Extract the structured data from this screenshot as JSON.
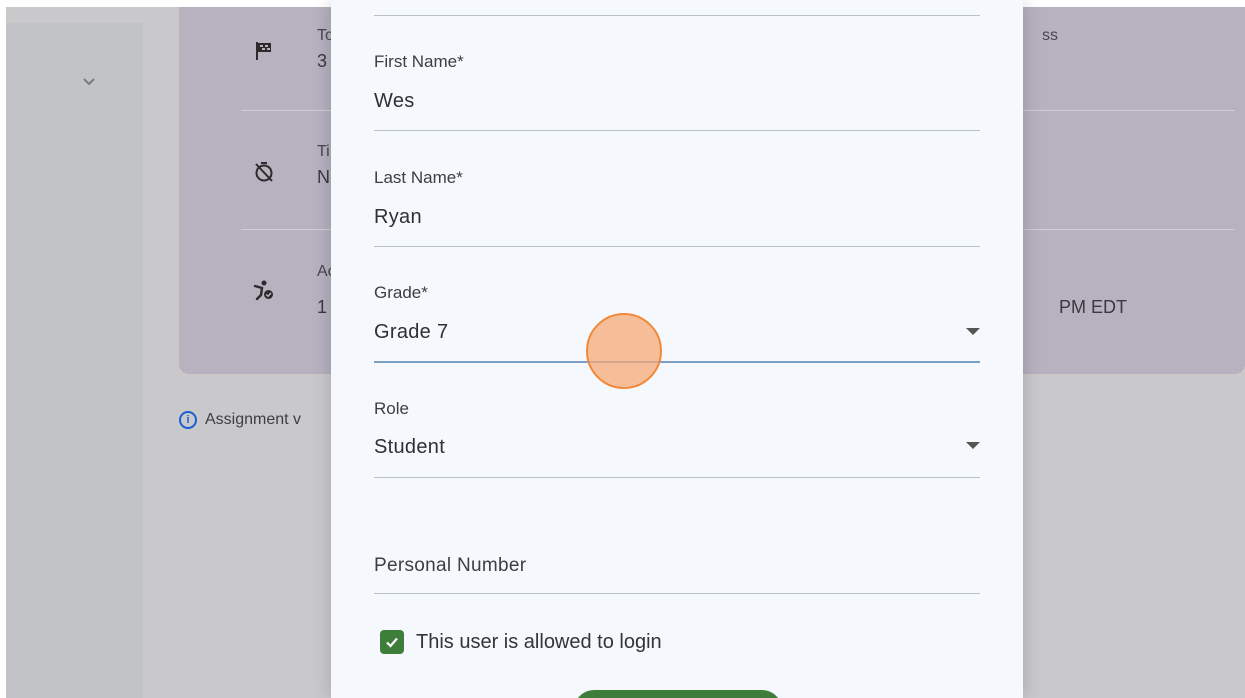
{
  "background_rows": [
    {
      "line1": "To",
      "line2": "3",
      "right_text": "ss",
      "icon": "checkered-flag-icon"
    },
    {
      "line1": "Ti",
      "line2": "N",
      "right_text": "",
      "icon": "timer-off-icon"
    },
    {
      "line1": "Ac",
      "line2": "1",
      "right_text": "PM EDT",
      "icon": "activity-icon"
    }
  ],
  "info_text": "Assignment v",
  "form": {
    "first_name": {
      "label": "First Name*",
      "value": "Wes"
    },
    "last_name": {
      "label": "Last Name*",
      "value": "Ryan"
    },
    "grade": {
      "label": "Grade*",
      "value": "Grade 7"
    },
    "role": {
      "label": "Role",
      "value": "Student"
    },
    "personal_number": {
      "placeholder": "Personal Number"
    },
    "login_checkbox": {
      "label": "This user is allowed to login",
      "checked": true
    }
  },
  "colors": {
    "accent_green": "#3f7d3b",
    "card_purple": "#b7b1c0",
    "info_blue": "#1a5fd0",
    "cursor_orange": "#f6aa78"
  }
}
